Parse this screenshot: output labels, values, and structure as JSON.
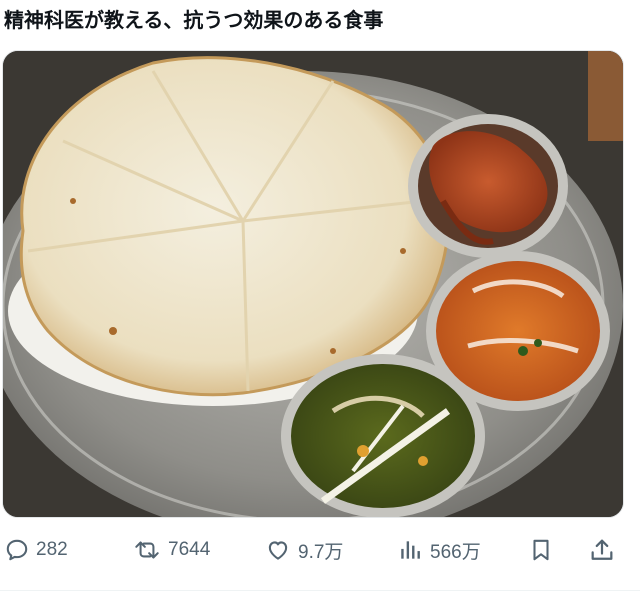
{
  "post": {
    "text": "精神科医が教える、抗うつ効果のある食事"
  },
  "media": {
    "image_icon": "photo-indian-thali-naan-curries"
  },
  "actions": {
    "reply_count": "282",
    "repost_count": "7644",
    "like_count": "9.7万",
    "view_count": "566万"
  },
  "icons": {
    "reply": "speech-bubble-icon",
    "repost": "repost-arrows-icon",
    "like": "heart-icon",
    "views": "bar-chart-icon",
    "bookmark": "bookmark-icon",
    "share": "share-upload-icon"
  },
  "colors": {
    "text": "#0f1419",
    "muted": "#536471",
    "divider": "#eff3f4"
  }
}
